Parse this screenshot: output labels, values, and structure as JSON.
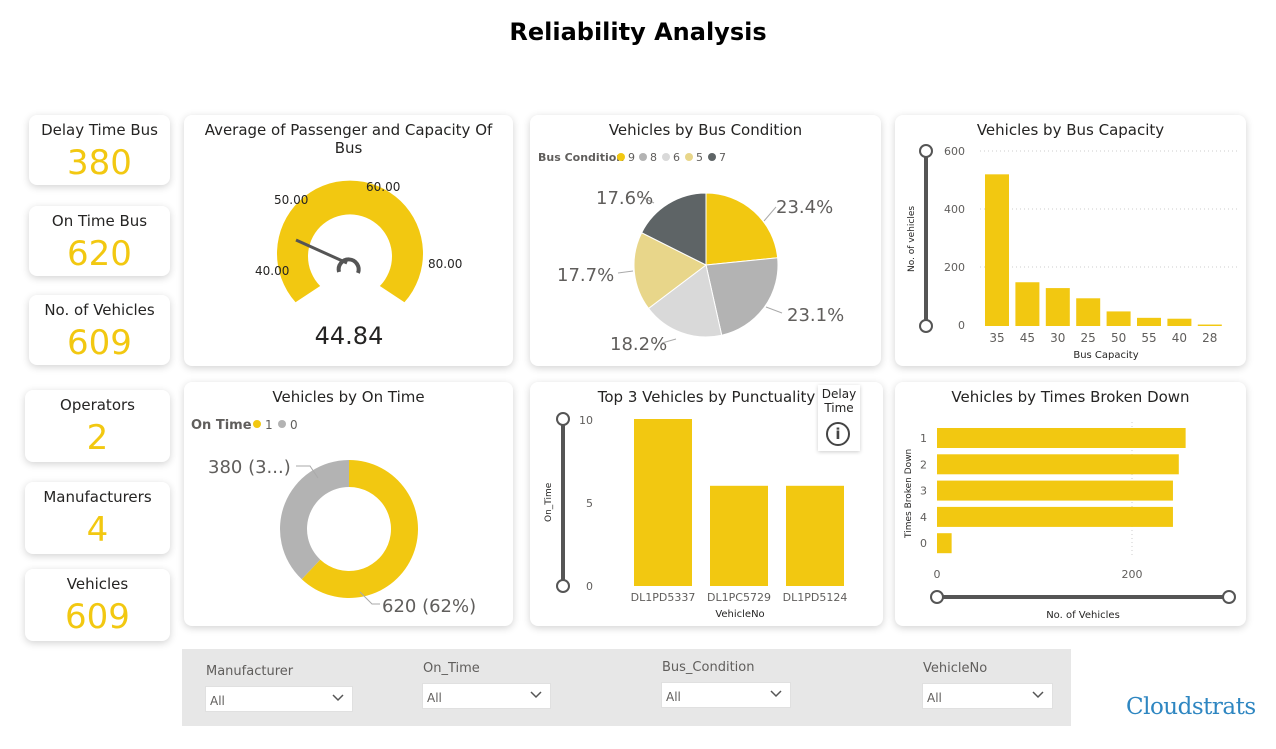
{
  "page": {
    "title": "Reliability Analysis"
  },
  "kpis": [
    {
      "label": "Delay Time Bus",
      "value": "380"
    },
    {
      "label": "On Time Bus",
      "value": "620"
    },
    {
      "label": "No. of Vehicles",
      "value": "609"
    },
    {
      "label": "Operators",
      "value": "2"
    },
    {
      "label": "Manufacturers",
      "value": "4"
    },
    {
      "label": "Vehicles",
      "value": "609"
    }
  ],
  "gauge": {
    "title": "Average of Passenger and Capacity Of Bus",
    "value_label": "44.84",
    "tick_labels": [
      "40.00",
      "50.00",
      "60.00",
      "80.00"
    ],
    "value": 44.84
  },
  "pie": {
    "title": "Vehicles by Bus Condition",
    "legend_title": "Bus Condition",
    "legend": [
      "9",
      "8",
      "6",
      "5",
      "7"
    ],
    "labels": [
      "23.4%",
      "23.1%",
      "18.2%",
      "17.7%",
      "17.6%"
    ]
  },
  "capacity": {
    "title": "Vehicles by Bus Capacity",
    "xlabel": "Bus Capacity",
    "ylabel": "No. of vehicles",
    "yticks": [
      "600",
      "400",
      "200",
      "0"
    ]
  },
  "donut": {
    "title": "Vehicles by On Time",
    "legend_title": "On Time",
    "legend": [
      "1",
      "0"
    ],
    "label_zero": "380 (3...)",
    "label_one": "620 (62%)"
  },
  "punctuality": {
    "title": "Top 3 Vehicles by Punctuality",
    "xlabel": "VehicleNo",
    "ylabel": "On_Time",
    "yticks": [
      "10",
      "5",
      "0"
    ],
    "tooltip": "Delay Time",
    "info_glyph": "i"
  },
  "broken": {
    "title": "Vehicles by Times Broken Down",
    "xlabel": "No. of Vehicles",
    "ylabel": "Times Broken Down",
    "xticks": [
      "0",
      "200"
    ]
  },
  "slicers": [
    {
      "label": "Manufacturer",
      "value": "All"
    },
    {
      "label": "On_Time",
      "value": "All"
    },
    {
      "label": "Bus_Condition",
      "value": "All"
    },
    {
      "label": "VehicleNo",
      "value": "All"
    }
  ],
  "logo": {
    "text": "Cloudstrats"
  },
  "colors": {
    "accent": "#F2C811",
    "gray_light": "#D9D9D9",
    "gray_mid": "#B3B3B3",
    "tan": "#E8D68A",
    "dark": "#5E6466",
    "text": "#252423"
  },
  "chart_data": [
    {
      "type": "pie",
      "title": "Vehicles by Bus Condition",
      "categories": [
        "9",
        "8",
        "6",
        "5",
        "7"
      ],
      "values": [
        23.4,
        23.1,
        18.2,
        17.7,
        17.6
      ]
    },
    {
      "type": "bar",
      "title": "Vehicles by Bus Capacity",
      "categories": [
        "35",
        "45",
        "30",
        "25",
        "50",
        "55",
        "40",
        "28"
      ],
      "values": [
        520,
        150,
        130,
        95,
        50,
        28,
        25,
        5
      ],
      "xlabel": "Bus Capacity",
      "ylabel": "No. of vehicles",
      "ylim": [
        0,
        600
      ]
    },
    {
      "type": "pie",
      "title": "Vehicles by On Time",
      "categories": [
        "1",
        "0"
      ],
      "values": [
        620,
        380
      ]
    },
    {
      "type": "bar",
      "title": "Top 3 Vehicles by Punctuality",
      "categories": [
        "DL1PD5337",
        "DL1PC5729",
        "DL1PD5124"
      ],
      "values": [
        10,
        6,
        6
      ],
      "xlabel": "VehicleNo",
      "ylabel": "On_Time",
      "ylim": [
        0,
        10
      ]
    },
    {
      "type": "bar",
      "title": "Vehicles by Times Broken Down",
      "categories": [
        "1",
        "2",
        "3",
        "4",
        "0"
      ],
      "values": [
        255,
        248,
        242,
        242,
        15
      ],
      "xlabel": "No. of Vehicles",
      "ylabel": "Times Broken Down",
      "xlim": [
        0,
        260
      ]
    }
  ]
}
